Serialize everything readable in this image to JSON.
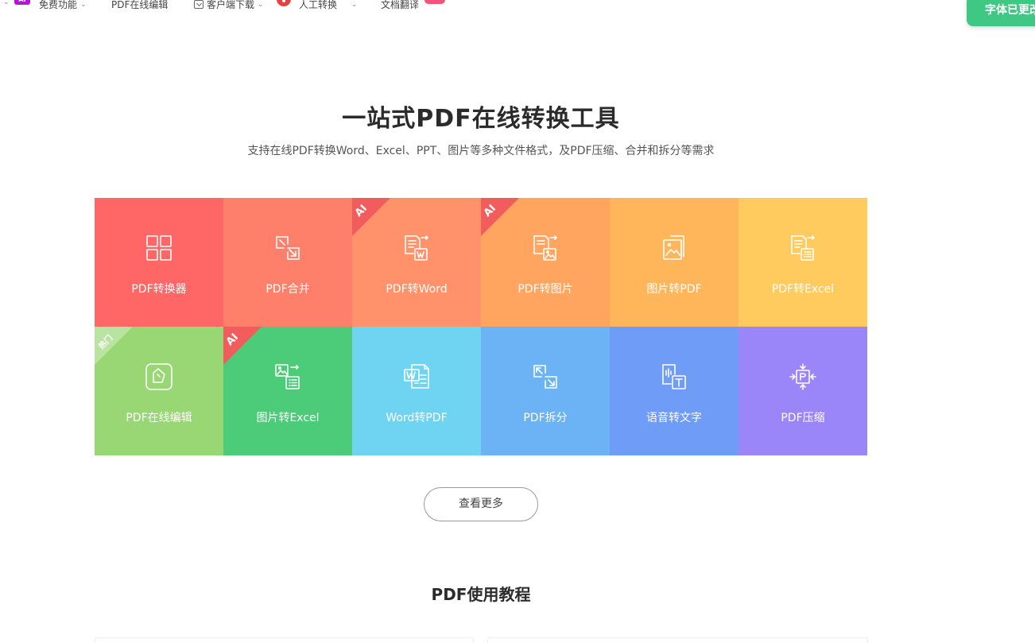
{
  "nav": {
    "logo": "AI",
    "free_features": "免费功能",
    "pdf_edit": "PDF在线编辑",
    "download": "客户端下载",
    "manual": "人工转换",
    "translate": "文档翻译"
  },
  "toast": "字体已更改",
  "hero": {
    "title": "一站式PDF在线转换工具",
    "subtitle": "支持在线PDF转换Word、Excel、PPT、图片等多种文件格式，及PDF压缩、合并和拆分等需求"
  },
  "tools": [
    {
      "label": "PDF转换器",
      "icon": "grid-icon",
      "color": "#ff6666",
      "badge": ""
    },
    {
      "label": "PDF合并",
      "icon": "merge-icon",
      "color": "#ff806a",
      "badge": ""
    },
    {
      "label": "PDF转Word",
      "icon": "word-convert-icon",
      "color": "#ff926a",
      "badge": "AI",
      "badge_color": "#f25c5c"
    },
    {
      "label": "PDF转图片",
      "icon": "image-convert-icon",
      "color": "#ffa55f",
      "badge": "AI",
      "badge_color": "#f25c5c"
    },
    {
      "label": "图片转PDF",
      "icon": "image-to-pdf-icon",
      "color": "#ffb65a",
      "badge": ""
    },
    {
      "label": "PDF转Excel",
      "icon": "excel-convert-icon",
      "color": "#ffcb5e",
      "badge": ""
    },
    {
      "label": "PDF在线编辑",
      "icon": "edit-icon",
      "color": "#98d774",
      "badge": "热门",
      "badge_color": "#b8e3a0"
    },
    {
      "label": "图片转Excel",
      "icon": "image-to-excel-icon",
      "color": "#4ccb78",
      "badge": "AI",
      "badge_color": "#f25c5c"
    },
    {
      "label": "Word转PDF",
      "icon": "word-to-pdf-icon",
      "color": "#6fd3f2",
      "badge": ""
    },
    {
      "label": "PDF拆分",
      "icon": "split-icon",
      "color": "#6cb3f5",
      "badge": ""
    },
    {
      "label": "语音转文字",
      "icon": "speech-to-text-icon",
      "color": "#6f9cf6",
      "badge": ""
    },
    {
      "label": "PDF压缩",
      "icon": "compress-icon",
      "color": "#9a86f9",
      "badge": ""
    }
  ],
  "more_button": "查看更多",
  "tutorial_title": "PDF使用教程"
}
